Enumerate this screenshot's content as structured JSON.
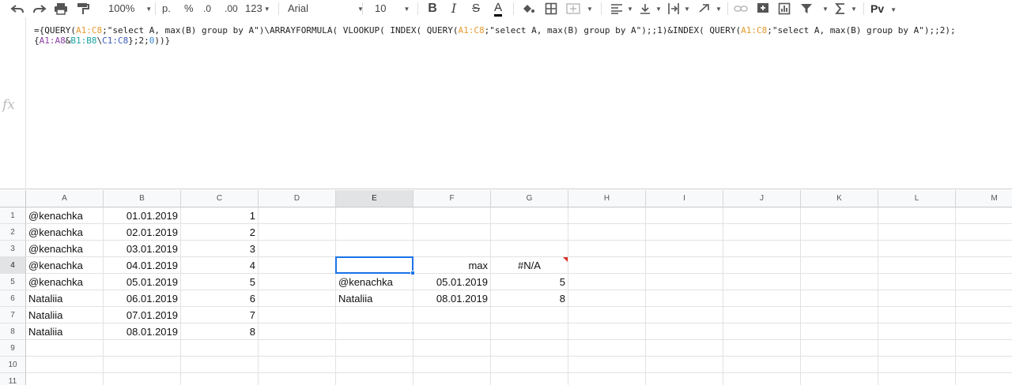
{
  "toolbar": {
    "zoom": "100%",
    "currency_label": "р.",
    "percent_label": "%",
    "dec_decrease_label": ".0",
    "dec_increase_label": ".00",
    "more_formats_label": "123",
    "font_name": "Arial",
    "font_size": "10",
    "bold_label": "B",
    "italic_label": "I",
    "strike_label": "S",
    "text_color_label": "A",
    "text_color": "#000000",
    "input_tools_label": "Рv"
  },
  "formula_bar": {
    "line1": [
      {
        "t": "={QUERY(",
        "c": ""
      },
      {
        "t": "A1:C8",
        "c": "ref-orange"
      },
      {
        "t": ";\"select A, max(B) group by A\")\\ARRAYFORMULA( VLOOKUP( INDEX( QUERY(",
        "c": ""
      },
      {
        "t": "A1:C8",
        "c": "ref-orange"
      },
      {
        "t": ";\"select A, max(B) group by A\");;1)&INDEX( QUERY(",
        "c": ""
      },
      {
        "t": "A1:C8",
        "c": "ref-orange"
      },
      {
        "t": ";\"select A, max(B) group by A\");;2);",
        "c": ""
      }
    ],
    "line2": [
      {
        "t": "{",
        "c": ""
      },
      {
        "t": "A1:A8",
        "c": "ref-purple"
      },
      {
        "t": "&",
        "c": ""
      },
      {
        "t": "B1:B8",
        "c": "ref-teal"
      },
      {
        "t": "\\",
        "c": ""
      },
      {
        "t": "C1:C8",
        "c": "ref-navy"
      },
      {
        "t": "};2;",
        "c": ""
      },
      {
        "t": "0",
        "c": "ref-blue"
      },
      {
        "t": "))}",
        "c": ""
      }
    ]
  },
  "columns": [
    "A",
    "B",
    "C",
    "D",
    "E",
    "F",
    "G",
    "H",
    "I",
    "J",
    "K",
    "L",
    "M"
  ],
  "rows": [
    "1",
    "2",
    "3",
    "4",
    "5",
    "6",
    "7",
    "8",
    "9",
    "10",
    "11"
  ],
  "cells": {
    "A1": "@kenachka",
    "B1": "01.01.2019",
    "C1": "1",
    "A2": "@kenachka",
    "B2": "02.01.2019",
    "C2": "2",
    "A3": "@kenachka",
    "B3": "03.01.2019",
    "C3": "3",
    "A4": "@kenachka",
    "B4": "04.01.2019",
    "C4": "4",
    "A5": "@kenachka",
    "B5": "05.01.2019",
    "C5": "5",
    "A6": "Nataliia",
    "B6": "06.01.2019",
    "C6": "6",
    "A7": "Nataliia",
    "B7": "07.01.2019",
    "C7": "7",
    "A8": "Nataliia",
    "B8": "08.01.2019",
    "C8": "8",
    "E4": "",
    "F4": "max",
    "G4": "#N/A",
    "E5": "@kenachka",
    "F5": "05.01.2019",
    "G5": "5",
    "E6": "Nataliia",
    "F6": "08.01.2019",
    "G6": "8"
  },
  "selected_cell": "E4",
  "error_cell": "G4",
  "colors": {
    "selection": "#1a73e8",
    "error": "#d93025",
    "header_bg": "#f8f9fa"
  }
}
